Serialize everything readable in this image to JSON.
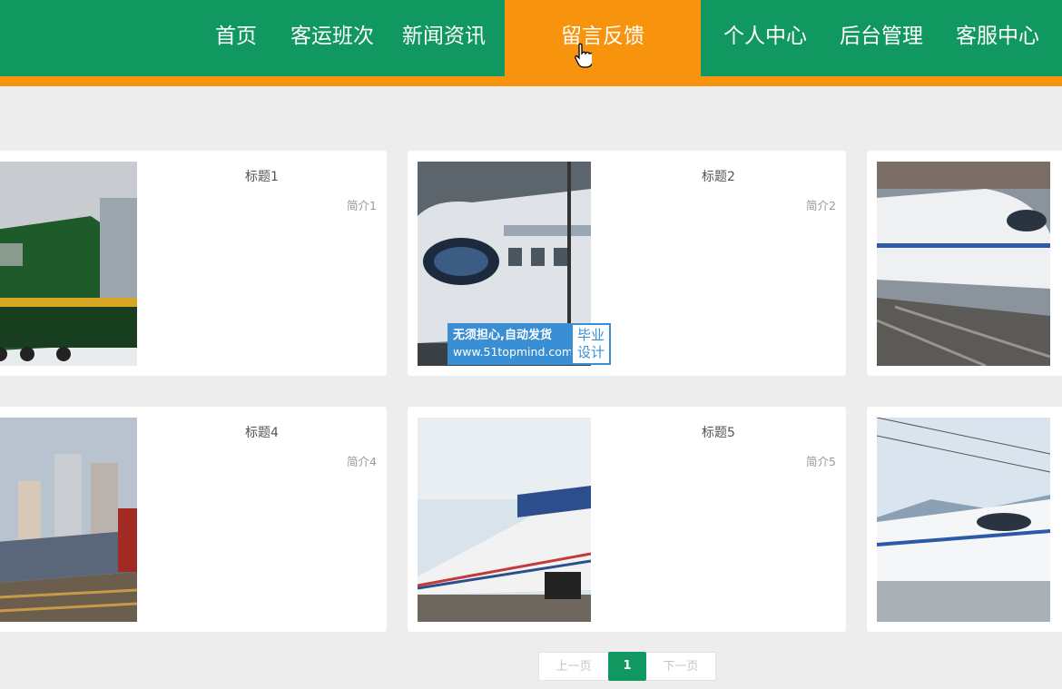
{
  "nav": {
    "items": [
      {
        "label": "首页"
      },
      {
        "label": "客运班次"
      },
      {
        "label": "新闻资讯"
      },
      {
        "label": "留言反馈",
        "active": true
      },
      {
        "label": "个人中心"
      },
      {
        "label": "后台管理"
      },
      {
        "label": "客服中心"
      }
    ]
  },
  "cards": [
    {
      "title": "标题1",
      "desc": "简介1",
      "image": "green-diesel-locomotive"
    },
    {
      "title": "标题2",
      "desc": "简介2",
      "image": "white-high-speed-train"
    },
    {
      "title": "",
      "desc": "",
      "image": "crh-high-speed-train"
    },
    {
      "title": "标题4",
      "desc": "简介4",
      "image": "red-locomotive-city"
    },
    {
      "title": "标题5",
      "desc": "简介5",
      "image": "blue-striped-locomotive"
    },
    {
      "title": "",
      "desc": "",
      "image": "crh-train-mountains"
    }
  ],
  "watermark": {
    "line1": "无须担心,自动发货",
    "line2": "www.51topmind.com",
    "badge_line1": "毕业",
    "badge_line2": "设计"
  },
  "pagination": {
    "prev": "上一页",
    "current": "1",
    "next": "下一页"
  },
  "colors": {
    "nav_bg": "#119760",
    "accent": "#f7930c",
    "page_bg": "#ededed",
    "watermark_blue": "#3a8fd4"
  }
}
